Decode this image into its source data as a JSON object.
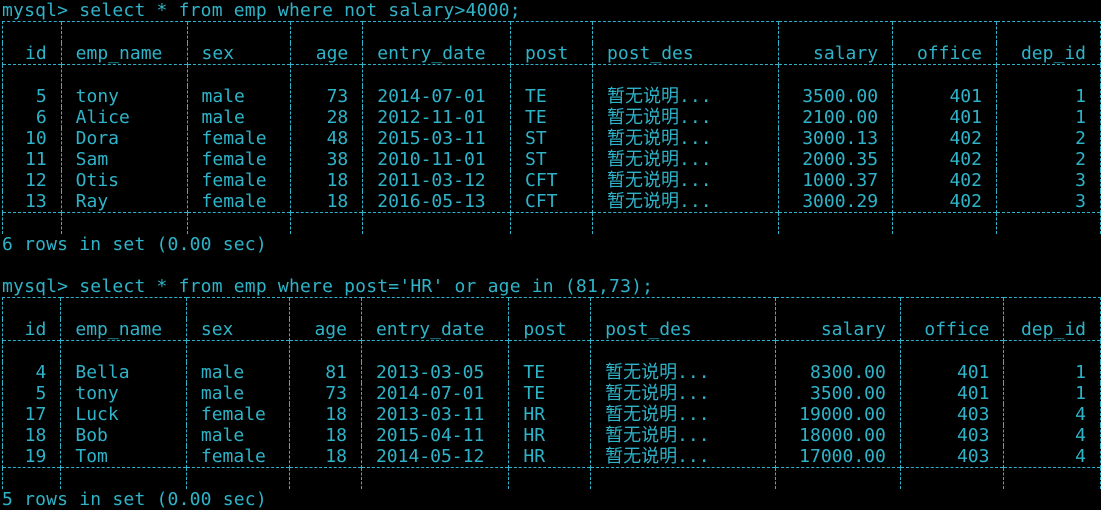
{
  "queries": [
    {
      "command": "mysql> select * from emp where not salary>4000;",
      "border": "+----+----------+--------+-----+------------+------+-------------+----------+--------+--------+",
      "columns": [
        "id",
        "emp_name",
        "sex",
        "age",
        "entry_date",
        "post",
        "post_des",
        "salary",
        "office",
        "dep_id"
      ],
      "rows": [
        [
          "5",
          "tony",
          "male",
          "73",
          "2014-07-01",
          "TE",
          "暂无说明...",
          "3500.00",
          "401",
          "1"
        ],
        [
          "6",
          "Alice",
          "male",
          "28",
          "2012-11-01",
          "TE",
          "暂无说明...",
          "2100.00",
          "401",
          "1"
        ],
        [
          "10",
          "Dora",
          "female",
          "48",
          "2015-03-11",
          "ST",
          "暂无说明...",
          "3000.13",
          "402",
          "2"
        ],
        [
          "11",
          "Sam",
          "female",
          "38",
          "2010-11-01",
          "ST",
          "暂无说明...",
          "2000.35",
          "402",
          "2"
        ],
        [
          "12",
          "Otis",
          "female",
          "18",
          "2011-03-12",
          "CFT",
          "暂无说明...",
          "1000.37",
          "402",
          "3"
        ],
        [
          "13",
          "Ray",
          "female",
          "18",
          "2016-05-13",
          "CFT",
          "暂无说明...",
          "3000.29",
          "402",
          "3"
        ]
      ],
      "summary": "6 rows in set (0.00 sec)"
    },
    {
      "command": "mysql> select * from emp where post='HR' or age in (81,73);",
      "border": "+----+----------+--------+-----+------------+------+-------------+----------+--------+--------+",
      "columns": [
        "id",
        "emp_name",
        "sex",
        "age",
        "entry_date",
        "post",
        "post_des",
        "salary",
        "office",
        "dep_id"
      ],
      "rows": [
        [
          "4",
          "Bella",
          "male",
          "81",
          "2013-03-05",
          "TE",
          "暂无说明...",
          "8300.00",
          "401",
          "1"
        ],
        [
          "5",
          "tony",
          "male",
          "73",
          "2014-07-01",
          "TE",
          "暂无说明...",
          "3500.00",
          "401",
          "1"
        ],
        [
          "17",
          "Luck",
          "female",
          "18",
          "2013-03-11",
          "HR",
          "暂无说明...",
          "19000.00",
          "403",
          "4"
        ],
        [
          "18",
          "Bob",
          "male",
          "18",
          "2015-04-11",
          "HR",
          "暂无说明...",
          "18000.00",
          "403",
          "4"
        ],
        [
          "19",
          "Tom",
          "female",
          "18",
          "2014-05-12",
          "HR",
          "暂无说明...",
          "17000.00",
          "403",
          "4"
        ]
      ],
      "summary": "5 rows in set (0.00 sec)"
    }
  ],
  "colors": {
    "background": "#000000",
    "text": "#2fb3c8"
  }
}
